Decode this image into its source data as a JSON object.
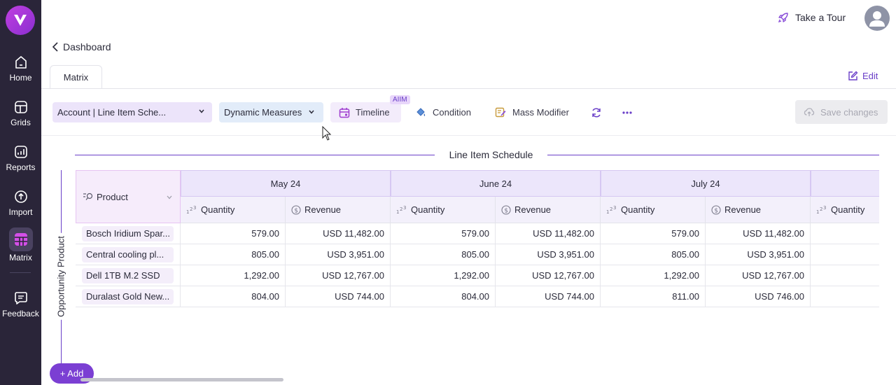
{
  "sidebar": {
    "items": [
      {
        "label": "Home",
        "icon": "home-icon"
      },
      {
        "label": "Grids",
        "icon": "grid-icon"
      },
      {
        "label": "Reports",
        "icon": "chart-icon"
      },
      {
        "label": "Import",
        "icon": "upload-icon"
      },
      {
        "label": "Matrix",
        "icon": "matrix-icon",
        "active": true
      },
      {
        "label": "Feedback",
        "icon": "feedback-icon"
      }
    ]
  },
  "topbar": {
    "tour_label": "Take a Tour"
  },
  "breadcrumb": {
    "back_label": "Dashboard"
  },
  "tabs": [
    {
      "label": "Matrix"
    }
  ],
  "edit_label": "Edit",
  "toolbar": {
    "dimension_select": "Account | Line Item Sche...",
    "measures_select": "Dynamic Measures",
    "timeline_label": "Timeline",
    "timeline_badge": "AIIM",
    "condition_label": "Condition",
    "mass_modifier_label": "Mass Modifier",
    "save_label": "Save changes"
  },
  "matrix": {
    "title": "Line Item Schedule",
    "row_dimension_label": "Opportunity Product",
    "product_header": "Product",
    "months": [
      "May 24",
      "June 24",
      "July 24"
    ],
    "measures": [
      "Quantity",
      "Revenue",
      "Quantity",
      "Revenue",
      "Quantity",
      "Revenue",
      "Quantity"
    ],
    "rows": [
      {
        "product": "Bosch Iridium Spar...",
        "values": [
          "579.00",
          "USD 11,482.00",
          "579.00",
          "USD 11,482.00",
          "579.00",
          "USD 11,482.00",
          ""
        ]
      },
      {
        "product": "Central cooling pl...",
        "values": [
          "805.00",
          "USD 3,951.00",
          "805.00",
          "USD 3,951.00",
          "805.00",
          "USD 3,951.00",
          ""
        ]
      },
      {
        "product": "Dell 1TB M.2 SSD",
        "values": [
          "1,292.00",
          "USD 12,767.00",
          "1,292.00",
          "USD 12,767.00",
          "1,292.00",
          "USD 12,767.00",
          ""
        ]
      },
      {
        "product": "Duralast Gold New...",
        "values": [
          "804.00",
          "USD 744.00",
          "804.00",
          "USD 744.00",
          "811.00",
          "USD 746.00",
          ""
        ]
      }
    ]
  },
  "add_label": "+ Add",
  "colors": {
    "accent": "#7b3fd3",
    "sidebar": "#2a2539",
    "logo": "#b43fe0"
  }
}
